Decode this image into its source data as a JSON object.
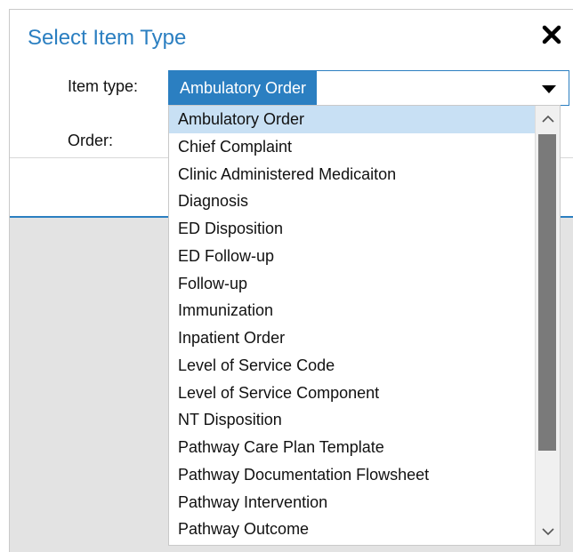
{
  "dialog": {
    "title": "Select Item Type",
    "close_icon": "close-icon"
  },
  "form": {
    "item_type_label": "Item type:",
    "item_type_value": "Ambulatory Order",
    "order_label": "Order:"
  },
  "dropdown": {
    "options": [
      "Ambulatory Order",
      "Chief Complaint",
      "Clinic Administered Medicaiton",
      "Diagnosis",
      "ED Disposition",
      "ED Follow-up",
      "Follow-up",
      "Immunization",
      "Inpatient Order",
      "Level of Service Code",
      "Level of Service Component",
      "NT Disposition",
      "Pathway Care Plan Template",
      "Pathway Documentation Flowsheet",
      "Pathway Intervention",
      "Pathway Outcome"
    ],
    "selected_index": 0
  },
  "colors": {
    "accent": "#2b7fc1",
    "selected_row": "#c8e0f4"
  }
}
